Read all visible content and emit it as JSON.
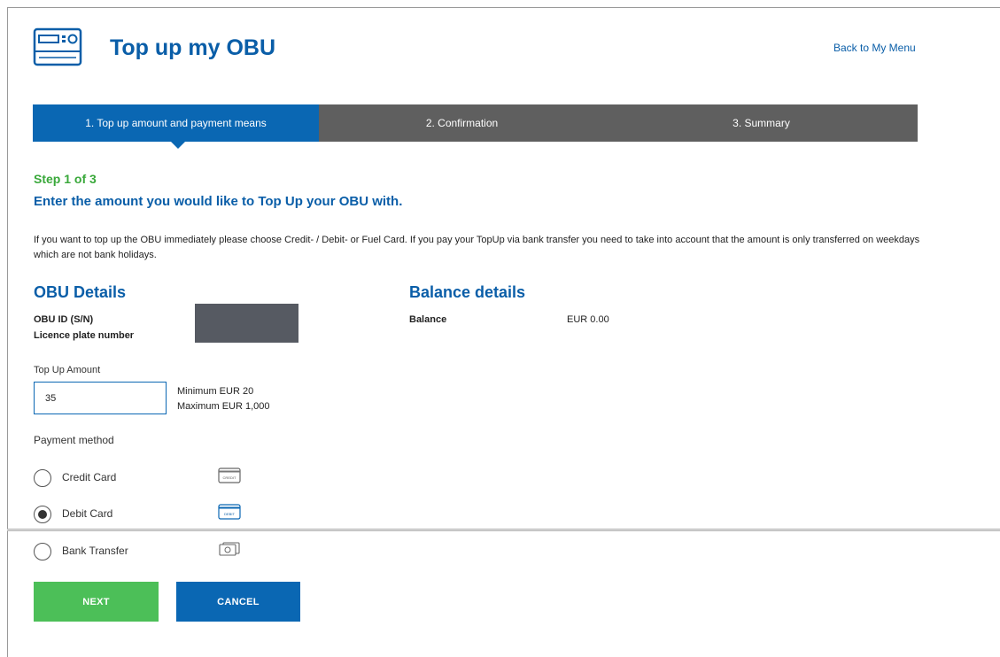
{
  "header": {
    "title": "Top up my OBU",
    "back_link": "Back to My Menu"
  },
  "steps": [
    {
      "label": "1. Top up amount and payment means",
      "active": true
    },
    {
      "label": "2. Confirmation",
      "active": false
    },
    {
      "label": "3. Summary",
      "active": false
    }
  ],
  "step_indicator": "Step 1 of 3",
  "heading": "Enter the amount you would like to Top Up your OBU with.",
  "info_text": "If you want to top up the OBU immediately please choose Credit- / Debit- or Fuel Card. If you pay your TopUp via bank transfer you need to take into account that the amount is only transferred on weekdays which are not bank holidays.",
  "obu_details": {
    "title": "OBU Details",
    "id_label": "OBU ID (S/N)",
    "plate_label": "Licence plate number"
  },
  "balance_details": {
    "title": "Balance details",
    "balance_label": "Balance",
    "balance_value": "EUR 0.00"
  },
  "top_up": {
    "label": "Top Up Amount",
    "value": "35",
    "min_text": "Minimum EUR 20",
    "max_text": "Maximum EUR 1,000"
  },
  "payment": {
    "label": "Payment method",
    "options": [
      {
        "label": "Credit Card",
        "selected": false,
        "icon": "credit-card-icon",
        "icon_text": "CREDIT"
      },
      {
        "label": "Debit Card",
        "selected": true,
        "icon": "debit-card-icon",
        "icon_text": "DEBIT"
      },
      {
        "label": "Bank Transfer",
        "selected": false,
        "icon": "bank-transfer-icon"
      }
    ]
  },
  "buttons": {
    "next": "NEXT",
    "cancel": "CANCEL"
  },
  "colors": {
    "brand_blue": "#0a67b3",
    "title_blue": "#0a5ea8",
    "step_grey": "#5f5f5f",
    "success_green": "#4cbf58",
    "step_indicator_green": "#39a83a"
  }
}
